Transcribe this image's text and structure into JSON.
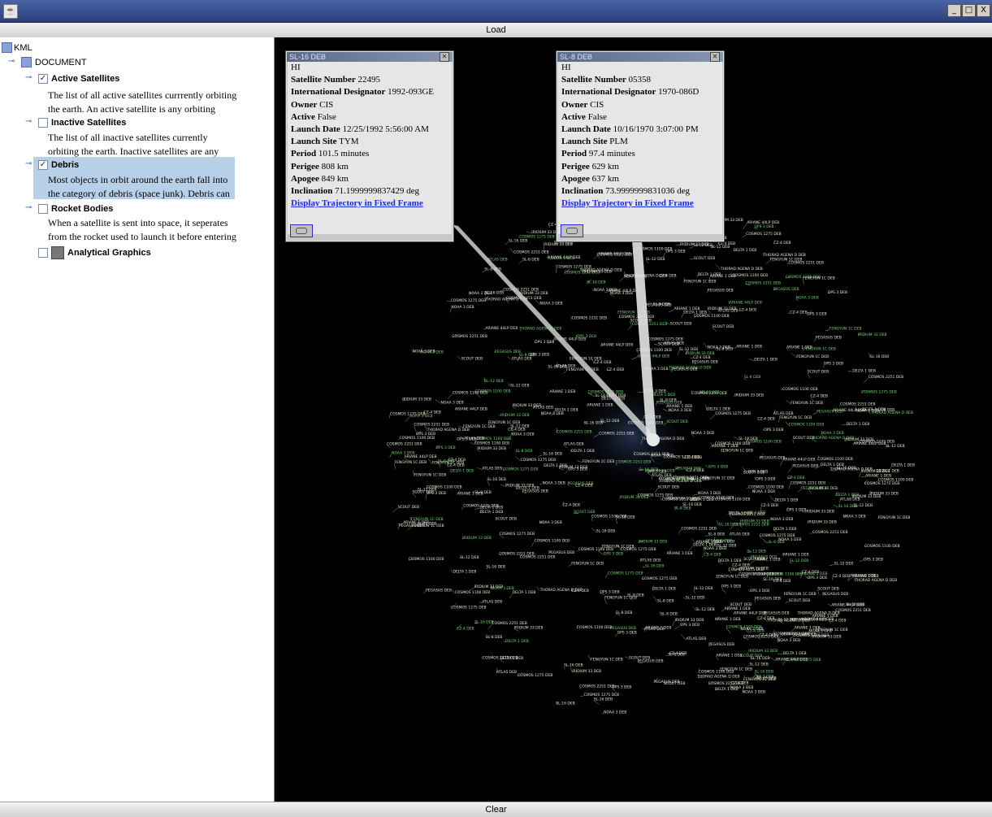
{
  "window": {
    "app_icon": "java-cup-icon",
    "controls": [
      "_",
      "□",
      "X"
    ]
  },
  "toolbar": {
    "load_label": "Load",
    "clear_label": "Clear"
  },
  "tree": {
    "root_label": "KML",
    "document_label": "DOCUMENT",
    "folders": [
      {
        "label": "Active Satellites",
        "checked": true,
        "desc_line1": "The list of all active satellites currrently orbiting",
        "desc_line2": "the earth. An active satellite is any orbiting"
      },
      {
        "label": "Inactive Satellites",
        "checked": false,
        "desc_line1": "The list of all inactive satellites currently",
        "desc_line2": "orbiting the earth. Inactive satellites are any"
      },
      {
        "label": "Debris",
        "checked": true,
        "desc_line1": "Most objects in orbit around the earth fall into",
        "desc_line2": "the category of debris (space junk). Debris can"
      },
      {
        "label": "Rocket Bodies",
        "checked": false,
        "desc_line1": "When a satellite is sent into space, it seperates",
        "desc_line2": "from the rocket used to launch it before entering"
      },
      {
        "label": "Analytical Graphics",
        "checked": false
      }
    ]
  },
  "popups": [
    {
      "title": "SL-16 DEB",
      "greeting": "HI",
      "satellite_number_label": "Satellite Number",
      "satellite_number": "22495",
      "designator_label": "International Designator",
      "designator": "1992-093GE",
      "owner_label": "Owner",
      "owner": "CIS",
      "active_label": "Active",
      "active": "False",
      "launch_date_label": "Launch Date",
      "launch_date": "12/25/1992 5:56:00 AM",
      "launch_site_label": "Launch Site",
      "launch_site": "TYM",
      "period_label": "Period",
      "period": "101.5 minutes",
      "perigee_label": "Perigee",
      "perigee": "808 km",
      "apogee_label": "Apogee",
      "apogee": "849 km",
      "inclination_label": "Inclination",
      "inclination": "71.1999999837429 deg",
      "link": "Display Trajectory in Fixed Frame"
    },
    {
      "title": "SL-8 DEB",
      "greeting": "HI",
      "satellite_number_label": "Satellite Number",
      "satellite_number": "05358",
      "designator_label": "International Designator",
      "designator": "1970-086D",
      "owner_label": "Owner",
      "owner": "CIS",
      "active_label": "Active",
      "active": "False",
      "launch_date_label": "Launch Date",
      "launch_date": "10/16/1970 3:07:00 PM",
      "launch_site_label": "Launch Site",
      "launch_site": "PLM",
      "period_label": "Period",
      "period": "97.4 minutes",
      "perigee_label": "Perigee",
      "perigee": "629 km",
      "apogee_label": "Apogee",
      "apogee": "637 km",
      "inclination_label": "Inclination",
      "inclination": "73.9999999831036 deg",
      "link": "Display Trajectory in Fixed Frame"
    }
  ],
  "globe_labels": [
    "COSMOS 1100 DEB",
    "ARIANE 1 DEB",
    "SL-8 DEB",
    "SL-16 DEB",
    "DELTA 1 DEB",
    "NOAA 3 DEB",
    "ARIANE 44LP DEB",
    "PEGASUS DEB",
    "FENGYUN 1C DEB",
    "CZ-4 DEB",
    "SL-12 DEB",
    "ATLAS DEB",
    "COSMOS 1275 DEB",
    "IRIDIUM 33 DEB",
    "COSMOS 2251 DEB",
    "THORAD AGENA D DEB",
    "SCOUT DEB",
    "OPS 3 DEB"
  ],
  "colors": {
    "label_white": "#e8e8d8",
    "label_green": "#7cd67c",
    "globe_tint": "#2a3a5a"
  }
}
